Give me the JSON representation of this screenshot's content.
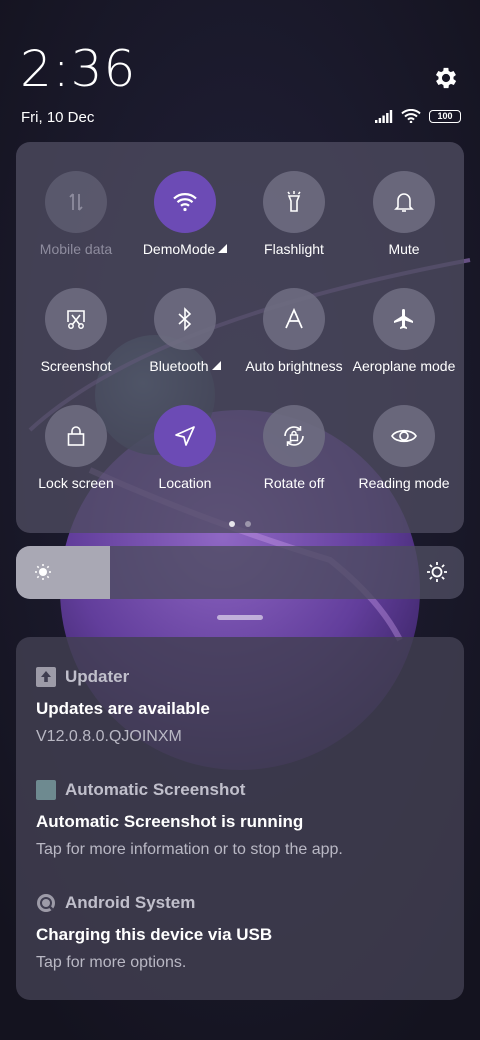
{
  "status": {
    "time": "2:36",
    "date": "Fri, 10 Dec",
    "battery": "100"
  },
  "quick_settings": [
    {
      "label": "Mobile data",
      "icon": "mobile-data-icon",
      "state": "disabled"
    },
    {
      "label": "DemoMode",
      "icon": "wifi-icon",
      "state": "active",
      "expandable": true
    },
    {
      "label": "Flashlight",
      "icon": "flashlight-icon",
      "state": "inactive"
    },
    {
      "label": "Mute",
      "icon": "bell-icon",
      "state": "inactive"
    },
    {
      "label": "Screenshot",
      "icon": "screenshot-icon",
      "state": "inactive"
    },
    {
      "label": "Bluetooth",
      "icon": "bluetooth-icon",
      "state": "inactive",
      "expandable": true
    },
    {
      "label": "Auto brightness",
      "icon": "auto-brightness-icon",
      "state": "inactive"
    },
    {
      "label": "Aeroplane mode",
      "icon": "airplane-icon",
      "state": "inactive"
    },
    {
      "label": "Lock screen",
      "icon": "lock-icon",
      "state": "inactive"
    },
    {
      "label": "Location",
      "icon": "location-icon",
      "state": "active"
    },
    {
      "label": "Rotate off",
      "icon": "rotate-lock-icon",
      "state": "inactive"
    },
    {
      "label": "Reading mode",
      "icon": "eye-icon",
      "state": "inactive"
    }
  ],
  "pager": {
    "pages": 2,
    "current": 1
  },
  "brightness": {
    "level": 0.21
  },
  "notifications": [
    {
      "app": "Updater",
      "app_icon": "updater-icon",
      "title": "Updates are available",
      "body": "V12.0.8.0.QJOINXM"
    },
    {
      "app": "Automatic Screenshot",
      "app_icon": "app-square-icon",
      "title": "Automatic Screenshot is running",
      "body": "Tap for more information or to stop the app."
    },
    {
      "app": "Android System",
      "app_icon": "android-system-icon",
      "title": "Charging this device via USB",
      "body": "Tap for more options."
    }
  ],
  "colors": {
    "active_tile": "#6c4bb5",
    "inactive_tile": "#706e82",
    "background": "#1b1a2e"
  }
}
